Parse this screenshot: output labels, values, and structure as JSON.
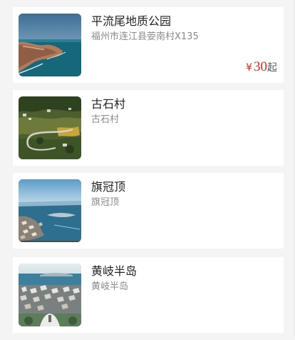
{
  "spots": [
    {
      "title": "平流尾地质公园",
      "address": "福州市连江县荌南村X135",
      "price_currency": "¥",
      "price_value": "30",
      "price_suffix": "起",
      "image_icon": "coastal-cliff-photo"
    },
    {
      "title": "古石村",
      "address": "古石村",
      "image_icon": "terraced-village-photo"
    },
    {
      "title": "旗冠顶",
      "address": "旗冠顶",
      "image_icon": "harbor-town-photo"
    },
    {
      "title": "黄岐半岛",
      "address": "黄岐半岛",
      "image_icon": "peninsula-town-photo"
    }
  ]
}
